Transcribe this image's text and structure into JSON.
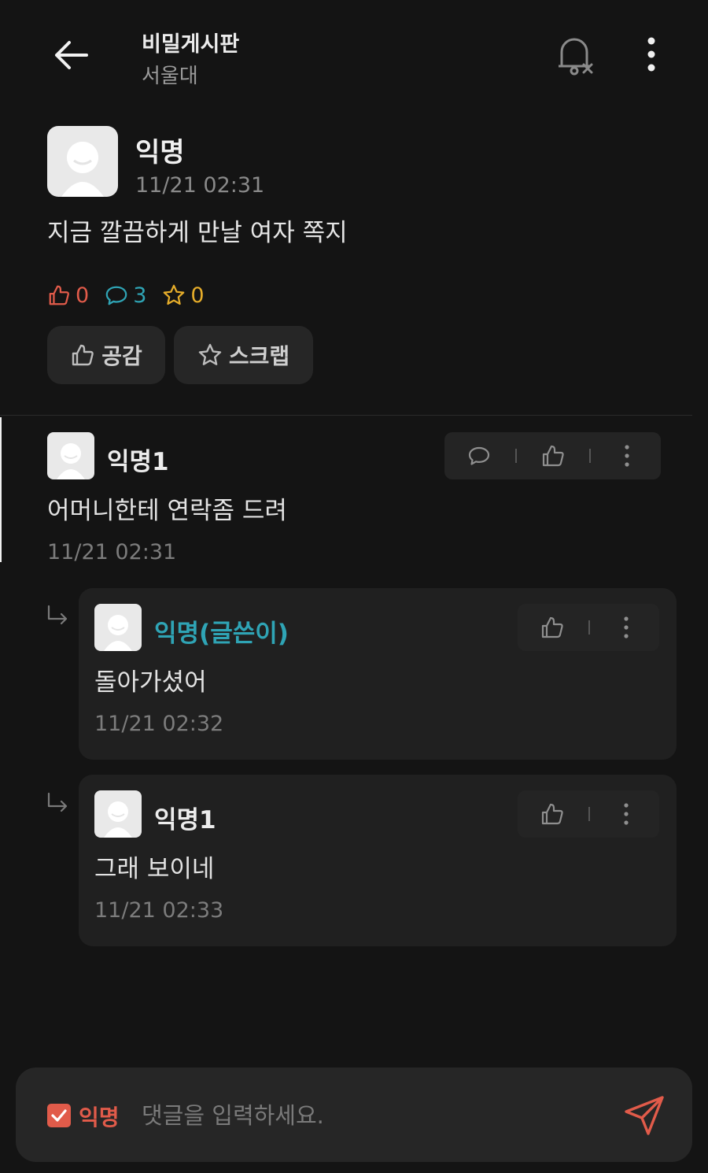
{
  "header": {
    "title": "비밀게시판",
    "subtitle": "서울대"
  },
  "post": {
    "author": "익명",
    "time": "11/21 02:31",
    "body": "지금 깔끔하게 만날 여자 쪽지",
    "likes": "0",
    "comments": "3",
    "scraps": "0",
    "like_button": "공감",
    "scrap_button": "스크랩"
  },
  "comments": [
    {
      "author": "익명1",
      "body": "어머니한테 연락좀 드려",
      "time": "11/21 02:31"
    }
  ],
  "replies": [
    {
      "author": "익명(글쓴이)",
      "body": "돌아가셨어",
      "time": "11/21 02:32"
    },
    {
      "author": "익명1",
      "body": "그래 보이네",
      "time": "11/21 02:33"
    }
  ],
  "input": {
    "anon_label": "익명",
    "placeholder": "댓글을 입력하세요.",
    "value": ""
  },
  "colors": {
    "background": "#141414",
    "like": "#e15b4a",
    "comment": "#2fa4b5",
    "scrap": "#e6ad2a",
    "op_author": "#2fa4b5"
  },
  "icons": [
    "back-arrow-icon",
    "bell-off-icon",
    "more-vertical-icon",
    "thumbs-up-icon",
    "speech-bubble-icon",
    "star-icon",
    "reply-arrow-icon",
    "checkbox-checked-icon",
    "send-icon"
  ]
}
